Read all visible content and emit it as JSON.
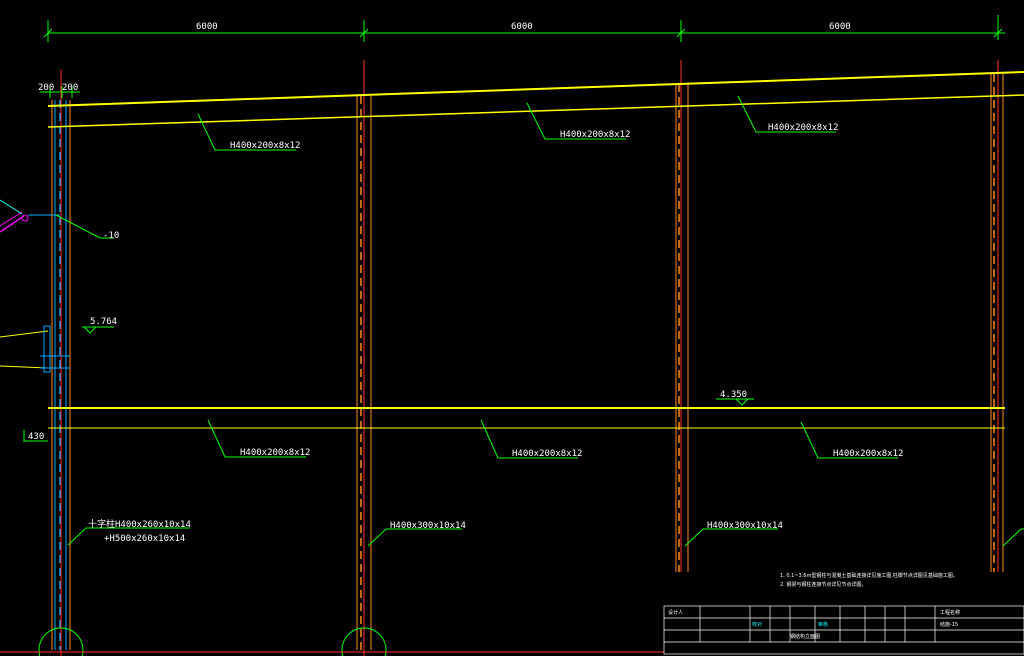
{
  "colors": {
    "background": "#000000",
    "beam": "#ffff00",
    "column_center": "#ff3030",
    "column_flange": "#ff8c1a",
    "column_web_cyan": "#00aaff",
    "annotation": "#00ff00",
    "text": "#ffffff",
    "title_block": "#ffffff",
    "title_text": "#00ffff",
    "brace": "#ff00ff"
  },
  "dimensions": {
    "bay_1": "6000",
    "bay_2": "6000",
    "bay_3": "6000",
    "left_offset_a": "200",
    "left_offset_b": "200"
  },
  "labels": {
    "roof_beam_1": "H400x200x8x12",
    "roof_beam_2": "H400x200x8x12",
    "roof_beam_3": "H400x200x8x12",
    "floor_beam_1": "H400x200x8x12",
    "floor_beam_2": "H400x200x8x12",
    "floor_beam_3": "H400x200x8x12",
    "plate": "-10",
    "level_5764": "5.764",
    "level_4350": "4.350",
    "level_430": "430",
    "col_a_line1": "十字柱H400x260x10x14",
    "col_a_line2": "+H500x260x10x14",
    "col_b": "H400x300x10x14",
    "col_c": "H400x300x10x14"
  },
  "notes": {
    "line1": "1. 0.1~3.6m型钢柱与混凝土基础连接详见施工图,柱脚节点详图见基础施工图。",
    "line2": "2. 钢梁与钢柱连接节点详见节点详图。"
  },
  "title_block": {
    "designer": "设计人",
    "checker": "校对",
    "approver": "审核",
    "project": "工程名称",
    "drawing": "钢结构立面图",
    "number": "结施-15"
  }
}
